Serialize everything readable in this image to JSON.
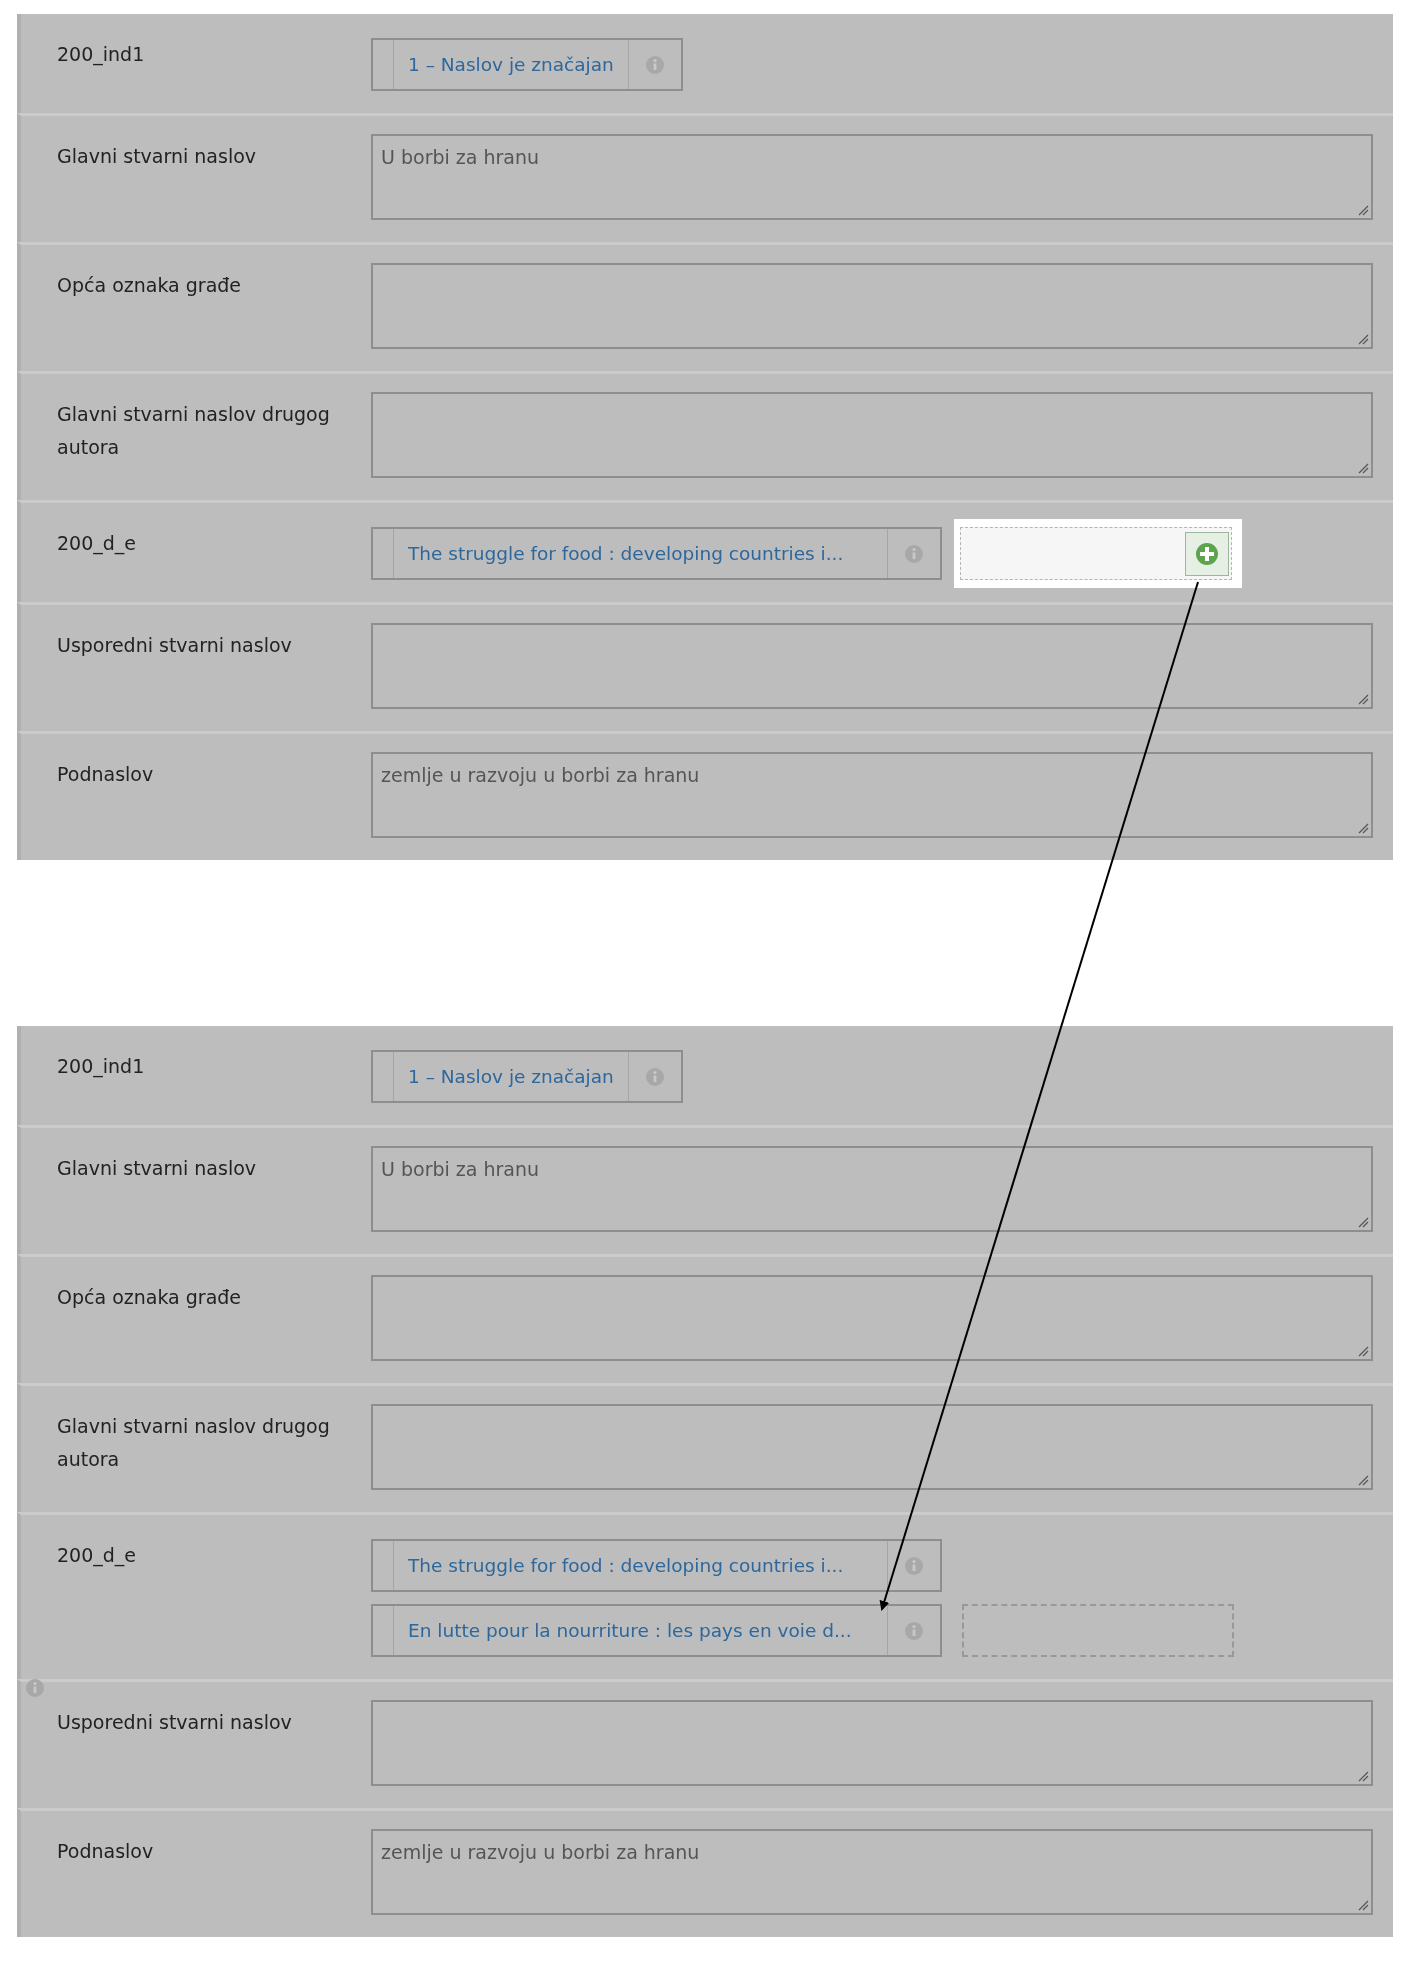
{
  "panels": [
    {
      "rows": [
        {
          "label": "200_ind1",
          "kind": "tags",
          "flagged": false,
          "tags": [
            "1 – Naslov je značajan"
          ]
        },
        {
          "label": "Glavni stvarni naslov",
          "kind": "textarea",
          "flagged": false,
          "value": "U borbi za hranu"
        },
        {
          "label": "Opća oznaka građe",
          "kind": "textarea",
          "flagged": false
        },
        {
          "label": "Glavni stvarni naslov drugog autora",
          "kind": "textarea",
          "flagged": false
        },
        {
          "label": "200_d_e",
          "kind": "tags",
          "flagged": false,
          "tags": [
            "The struggle for food : developing countries i..."
          ],
          "drop_zone": {
            "highlighted": true
          }
        },
        {
          "label": "Usporedni stvarni naslov",
          "kind": "textarea",
          "flagged": false
        },
        {
          "label": "Podnaslov",
          "kind": "textarea",
          "flagged": false,
          "value": "zemlje u razvoju u borbi za hranu"
        }
      ]
    },
    {
      "rows": [
        {
          "label": "200_ind1",
          "kind": "tags",
          "flagged": false,
          "tags": [
            "1 – Naslov je značajan"
          ]
        },
        {
          "label": "Glavni stvarni naslov",
          "kind": "textarea",
          "flagged": false,
          "value": "U borbi za hranu"
        },
        {
          "label": "Opća oznaka građe",
          "kind": "textarea",
          "flagged": false
        },
        {
          "label": "Glavni stvarni naslov drugog autora",
          "kind": "textarea",
          "flagged": false
        },
        {
          "label": "200_d_e",
          "kind": "tags",
          "flagged": false,
          "tags": [
            "The struggle for food : developing countries i...",
            "En lutte pour la nourriture : les pays en voie d..."
          ],
          "drop_zone": {
            "highlighted": false
          }
        },
        {
          "label": "Usporedni stvarni naslov",
          "kind": "textarea",
          "flagged": true
        },
        {
          "label": "Podnaslov",
          "kind": "textarea",
          "flagged": false,
          "value": "zemlje u razvoju u borbi za hranu"
        }
      ]
    }
  ]
}
